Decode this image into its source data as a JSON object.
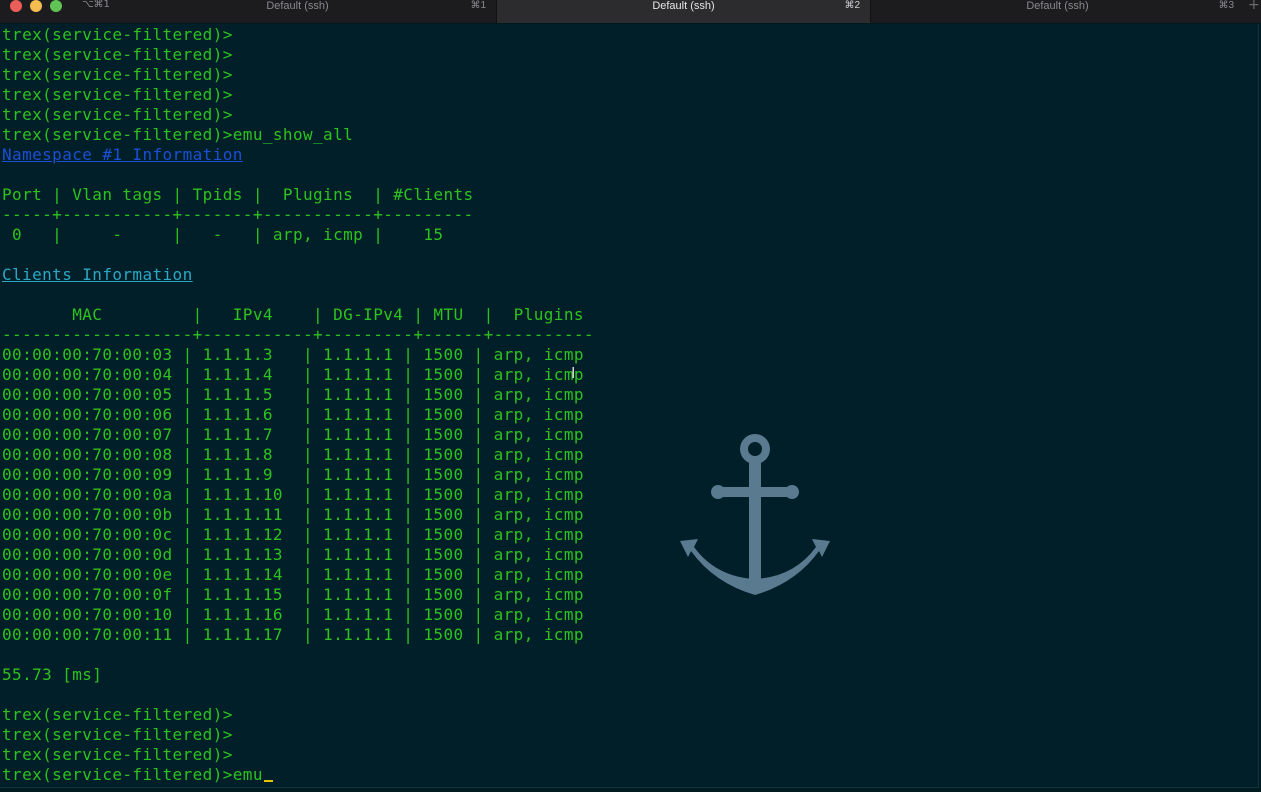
{
  "window": {
    "shortcut": "⌥⌘1",
    "tabs": [
      {
        "label": "Default (ssh)",
        "key": "⌘1",
        "active": false
      },
      {
        "label": "Default (ssh)",
        "key": "⌘2",
        "active": true
      },
      {
        "label": "Default (ssh)",
        "key": "⌘3",
        "active": false
      }
    ],
    "new_tab_symbol": "+"
  },
  "terminal": {
    "prompt": "trex(service-filtered)>",
    "lines": [
      "trex(service-filtered)>",
      "trex(service-filtered)>",
      "trex(service-filtered)>",
      "trex(service-filtered)>",
      "trex(service-filtered)>",
      "trex(service-filtered)>emu_show_all",
      "Namespace #1 Information",
      "",
      "Port | Vlan tags | Tpids |  Plugins  | #Clients",
      "-----+-----------+-------+-----------+---------",
      " 0   |     -     |   -   | arp, icmp |    15",
      "",
      "Clients Information",
      "",
      "       MAC         |   IPv4    | DG-IPv4 | MTU  |  Plugins",
      "-------------------+-----------+---------+------+----------",
      "00:00:00:70:00:03 | 1.1.1.3   | 1.1.1.1 | 1500 | arp, icmp",
      "00:00:00:70:00:04 | 1.1.1.4   | 1.1.1.1 | 1500 | arp, icmp",
      "00:00:00:70:00:05 | 1.1.1.5   | 1.1.1.1 | 1500 | arp, icmp",
      "00:00:00:70:00:06 | 1.1.1.6   | 1.1.1.1 | 1500 | arp, icmp",
      "00:00:00:70:00:07 | 1.1.1.7   | 1.1.1.1 | 1500 | arp, icmp",
      "00:00:00:70:00:08 | 1.1.1.8   | 1.1.1.1 | 1500 | arp, icmp",
      "00:00:00:70:00:09 | 1.1.1.9   | 1.1.1.1 | 1500 | arp, icmp",
      "00:00:00:70:00:0a | 1.1.1.10  | 1.1.1.1 | 1500 | arp, icmp",
      "00:00:00:70:00:0b | 1.1.1.11  | 1.1.1.1 | 1500 | arp, icmp",
      "00:00:00:70:00:0c | 1.1.1.12  | 1.1.1.1 | 1500 | arp, icmp",
      "00:00:00:70:00:0d | 1.1.1.13  | 1.1.1.1 | 1500 | arp, icmp",
      "00:00:00:70:00:0e | 1.1.1.14  | 1.1.1.1 | 1500 | arp, icmp",
      "00:00:00:70:00:0f | 1.1.1.15  | 1.1.1.1 | 1500 | arp, icmp",
      "00:00:00:70:00:10 | 1.1.1.16  | 1.1.1.1 | 1500 | arp, icmp",
      "00:00:00:70:00:11 | 1.1.1.17  | 1.1.1.1 | 1500 | arp, icmp",
      "",
      "55.73 [ms]",
      "",
      "trex(service-filtered)>",
      "trex(service-filtered)>",
      "trex(service-filtered)>",
      "trex(service-filtered)>emu"
    ],
    "link_lines": {
      "6": "blue",
      "12": "cyan"
    },
    "cursor_line": 37,
    "colors": {
      "background": "#001f28",
      "text": "#2ec21f",
      "link_blue": "#1a4fd6",
      "link_cyan": "#2aa8c4",
      "cursor": "#e5c400",
      "anchor": "#5a7a90"
    },
    "watermark_icon": "anchor-icon",
    "pointer_icon": "ibeam-cursor-icon"
  }
}
